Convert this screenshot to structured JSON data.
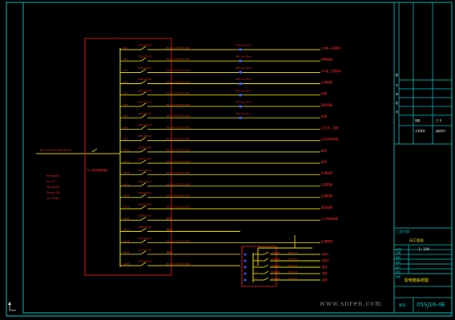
{
  "title_block": {
    "top_rows": [
      {
        "label": "图",
        "value": "",
        "extra": ""
      },
      {
        "label": "专",
        "value": "",
        "extra": ""
      },
      {
        "label": "审",
        "value": "",
        "extra": ""
      },
      {
        "label": "校",
        "value": "",
        "extra": ""
      },
      {
        "label": "设",
        "value": "",
        "extra": ""
      },
      {
        "label": "",
        "value": "制图",
        "extra": "王 东"
      },
      {
        "label": "",
        "value": "大学教育",
        "extra": "建筑电气"
      }
    ],
    "project_label": "工程名称：",
    "project_name": "员工宿舍",
    "scale_label": "比例",
    "scale_value": "1 : 100",
    "info_labels": [
      "日期",
      "图别",
      "审核",
      "设计",
      "校对",
      "制图"
    ],
    "drawing_title": "配电箱系统图",
    "drawing_no_label": "图号",
    "drawing_no": "05SJ16-4E"
  },
  "panel": {
    "incoming_cable": "BV-3×25+2×16SC40-FC",
    "panel_label": "2AL 配电箱照明柜",
    "specs": [
      "Pe=60kW",
      "Kx=0.7",
      "Pjs=42kW",
      "Cos φ=0.8",
      "Ijs=79.8A"
    ]
  },
  "circuits": [
    {
      "id": "WL1",
      "breaker": "C65N-C16/1P",
      "cable": "BV-3×2.5 SC15 WC",
      "load": "3#楼一层照明1"
    },
    {
      "id": "WL2",
      "breaker": "C65N-C16/1P",
      "cable": "BV-3×2.5 SC15 WC",
      "load": "照明插座"
    },
    {
      "id": "WL3",
      "breaker": "C65N-C16/1P",
      "cable": "BV-3×2.5 SC15 WC",
      "load": "3#楼二层照明2"
    },
    {
      "id": "WL4",
      "breaker": "C65N-C16/1P",
      "cable": "BV-3×2.5 SC15 WC",
      "load": "空调插座"
    },
    {
      "id": "WL5",
      "breaker": "C65N-C16/1P",
      "cable": "BV-3×2.5 SC15 WC",
      "load": "插座"
    },
    {
      "id": "WL6",
      "breaker": "C65N-C16/1P",
      "cable": "BV-3×2.5 SC15 WC",
      "load": "厨房插座"
    },
    {
      "id": "WL7",
      "breaker": "C65N-C16/1P",
      "cable": "BV-3×2.5 SC15 WC",
      "load": "插座"
    },
    {
      "id": "WL8",
      "breaker": "C65N-C16/1P",
      "cable": "BV-3×2.5 SC15 WC",
      "load": "卫生间、插座"
    },
    {
      "id": "WL9",
      "breaker": "C65N-C16/1P",
      "cable": "BV-3×2.5 SC15 WC",
      "load": "应急照明插座"
    },
    {
      "id": "WL10",
      "breaker": "C65N-C16/1P",
      "cable": "BV-3×2.5 SC15 WC",
      "load": "备用"
    },
    {
      "id": "WL11",
      "breaker": "C65N-C16/1P",
      "cable": "BV-3×2.5 SC15 WC",
      "load": "备用"
    },
    {
      "id": "WL12",
      "breaker": "C65N-C16/1P",
      "cable": "BV-3×2.5 SC15 WC",
      "load": "空调插座"
    },
    {
      "id": "WL13",
      "breaker": "C65N-C16/1P",
      "cable": "BV-3×2.5 SC15 WC",
      "load": "空调插座"
    },
    {
      "id": "WL14",
      "breaker": "C65N-C16/1P",
      "cable": "BV-3×2.5 SC15 WC",
      "load": "空调插座"
    },
    {
      "id": "WL15",
      "breaker": "C65N-C16/1P",
      "cable": "BV-3×2.5 SC15 WC",
      "load": "厨房插座"
    },
    {
      "id": "WL16",
      "breaker": "C65N-C16/1P",
      "cable": "备用",
      "load": "130插座插座"
    },
    {
      "id": "WL17",
      "breaker": "C65N-C16/1P",
      "cable": "备用",
      "load": ""
    },
    {
      "id": "WL18",
      "breaker": "C65N-C16/1P",
      "cable": "BV-3×2.5 SC15 WC",
      "load": "走廊照明"
    },
    {
      "id": "WL19",
      "breaker": "C65N-C16/1P",
      "cable": "备用",
      "load": ""
    },
    {
      "id": "WL20",
      "breaker": "C65N-C16/1P",
      "cable": "BV-3×2.5 SC15 WC",
      "load": ""
    }
  ],
  "rcd_labels": [
    "DPN Vigi 30mA",
    "DPN Vigi 30mA",
    "DPN Vigi 30mA",
    "DPN Vigi 30mA",
    "DPN Vigi 30mA",
    "DPN Vigi 30mA",
    "DPN Vigi 30mA"
  ],
  "sub_panel": {
    "rows": [
      {
        "id": "n1",
        "breaker": "C65N-C16",
        "cable": "BV-3×2.5",
        "load": "照明1"
      },
      {
        "id": "n2",
        "breaker": "C65N-C16",
        "cable": "BV-3×2.5",
        "load": "照明2"
      },
      {
        "id": "n3",
        "breaker": "C65N-C16",
        "cable": "BV-3×2.5",
        "load": "插座"
      },
      {
        "id": "n4",
        "breaker": "C65N-C16",
        "cable": "BV-3×2.5",
        "load": "插座"
      },
      {
        "id": "n5",
        "breaker": "C65N-C16",
        "cable": "BV-3×2.5",
        "load": "插座"
      }
    ]
  },
  "watermark": "www.snren.com",
  "colors": {
    "frame": "#00c8c8",
    "panel": "#d01818",
    "bus": "#e8e000",
    "text_red": "#ff2a2a",
    "ct": "#3a5cff",
    "background": "#000000"
  }
}
